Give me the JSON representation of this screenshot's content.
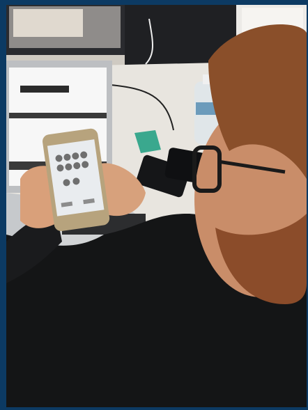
{
  "image": {
    "alt": "",
    "scene": "person-holding-smartphone-at-desk"
  },
  "palette": {
    "border": "#0c3a63",
    "desk": "#e8e5df",
    "laptop": "#b9bcbf",
    "jacket": "#141516",
    "skin": "#d9a07a",
    "hair": "#8a4f2a",
    "phone_screen": "#e9ecef"
  }
}
